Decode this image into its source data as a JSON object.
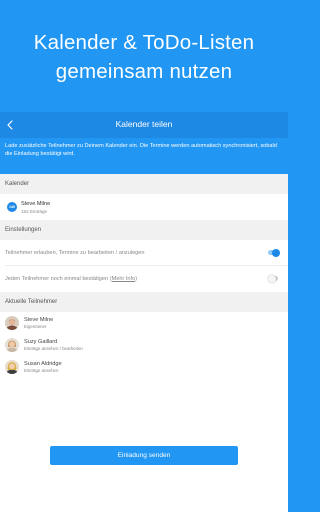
{
  "promo": {
    "line1": "Kalender & ToDo-Listen",
    "line2": "gemeinsam nutzen"
  },
  "appbar": {
    "title": "Kalender teilen",
    "back_icon": "arrow-left-icon"
  },
  "info_text": "Lade zusätzliche Teilnehmer zu Deinem Kalender ein. Die Termine werden automatisch synchronisiert, sobald die Einladung bestätigt wird.",
  "calendar_section": {
    "header": "Kalender",
    "item": {
      "badge": "140",
      "name": "Steve Milne",
      "subtitle": "152 Einträge"
    }
  },
  "settings_section": {
    "header": "Einstellungen",
    "items": [
      {
        "label": "Teilnehmer erlauben, Termine zu bearbeiten / anzulegen",
        "link": "",
        "suffix": "",
        "on": true
      },
      {
        "label": "Jeden Teilnehmer noch einmal bestätigen (",
        "link": "Mehr Info",
        "suffix": ")",
        "on": false
      }
    ]
  },
  "participants_section": {
    "header": "Aktuelle Teilnehmer",
    "people": [
      {
        "name": "Steve Milne",
        "role": "Eigentümer",
        "avatar": "man-avatar"
      },
      {
        "name": "Suzy Gaillard",
        "role": "Einträge ansehen / bearbeiten",
        "avatar": "woman-avatar"
      },
      {
        "name": "Susan Aldridge",
        "role": "Einträge ansehen",
        "avatar": "woman-avatar"
      }
    ]
  },
  "send_button": "Einladung senden",
  "colors": {
    "primary": "#2196f3",
    "appbar": "#1e88e5",
    "background": "#f1f1f1"
  }
}
